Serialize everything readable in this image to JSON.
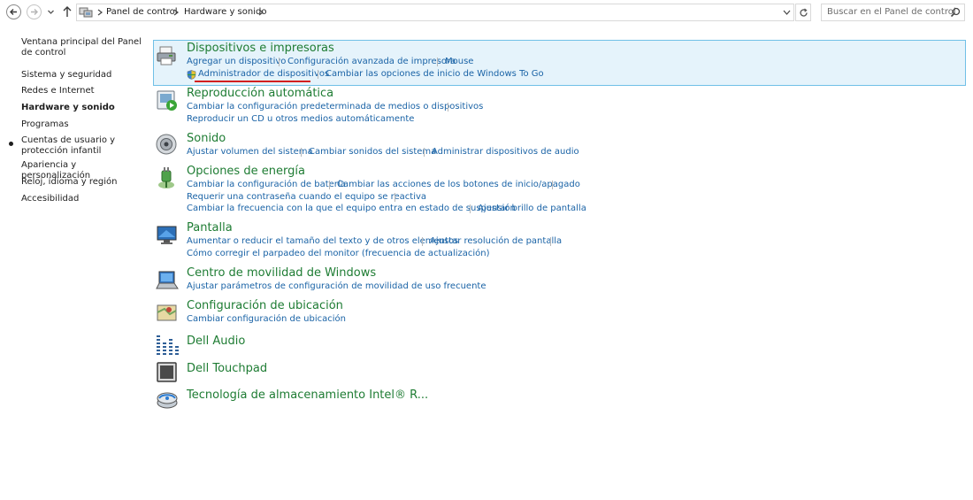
{
  "address": {
    "crumbs": [
      "Panel de control",
      "Hardware y sonido"
    ],
    "search_placeholder": "Buscar en el Panel de control"
  },
  "sidebar": {
    "items": [
      {
        "label": "Ventana principal del Panel de control"
      },
      {
        "label": "Sistema y seguridad"
      },
      {
        "label": "Redes e Internet"
      },
      {
        "label": "Hardware y sonido"
      },
      {
        "label": "Programas"
      },
      {
        "label": "Cuentas de usuario y protección infantil"
      },
      {
        "label": "Apariencia y personalización"
      },
      {
        "label": "Reloj, idioma y región"
      },
      {
        "label": "Accesibilidad"
      }
    ]
  },
  "categories": {
    "devices": {
      "title": "Dispositivos e impresoras",
      "links": [
        "Agregar un dispositivo",
        "Configuración avanzada de impresora",
        "Mouse",
        "Administrador de dispositivos",
        "Cambiar las opciones de inicio de Windows To Go"
      ]
    },
    "autoplay": {
      "title": "Reproducción automática",
      "links": [
        "Cambiar la configuración predeterminada de medios o dispositivos",
        "Reproducir un CD u otros medios automáticamente"
      ]
    },
    "sound": {
      "title": "Sonido",
      "links": [
        "Ajustar volumen del sistema",
        "Cambiar sonidos del sistema",
        "Administrar dispositivos de audio"
      ]
    },
    "power": {
      "title": "Opciones de energía",
      "links": [
        "Cambiar la configuración de batería",
        "Cambiar las acciones de los botones de inicio/apagado",
        "Requerir una contraseña cuando el equipo se reactiva",
        "Cambiar la frecuencia con la que el equipo entra en estado de suspensión",
        "Ajustar brillo de pantalla"
      ]
    },
    "display": {
      "title": "Pantalla",
      "links": [
        "Aumentar o reducir el tamaño del texto y de otros elementos",
        "Ajustar resolución de pantalla",
        "Cómo corregir el parpadeo del monitor (frecuencia de actualización)"
      ]
    },
    "mobility": {
      "title": "Centro de movilidad de Windows",
      "links": [
        "Ajustar parámetros de configuración de movilidad de uso frecuente"
      ]
    },
    "location": {
      "title": "Configuración de ubicación",
      "links": [
        "Cambiar configuración de ubicación"
      ]
    },
    "dell_audio": {
      "title": "Dell Audio"
    },
    "dell_touchpad": {
      "title": "Dell Touchpad"
    },
    "intel_storage": {
      "title": "Tecnología de almacenamiento Intel® R..."
    }
  },
  "colors": {
    "category_title": "#1e7c33",
    "link": "#1a63a6",
    "highlight_bg": "#e5f3fb",
    "highlight_border": "#70c0e7",
    "annotation_underline": "#d21f1f"
  },
  "icons": [
    "back-arrow-icon",
    "forward-arrow-icon",
    "up-arrow-icon",
    "control-panel-icon",
    "refresh-icon",
    "search-icon",
    "printer-icon",
    "autoplay-icon",
    "speaker-icon",
    "power-plug-icon",
    "monitor-icon",
    "mobility-laptop-icon",
    "location-icon",
    "audio-bars-icon",
    "touchpad-icon",
    "intel-storage-icon",
    "uac-shield-icon"
  ]
}
